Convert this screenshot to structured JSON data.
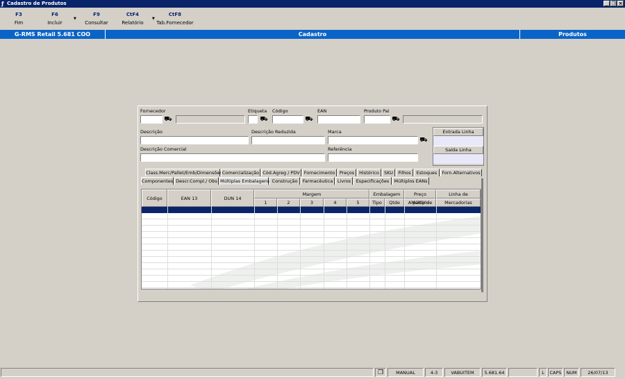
{
  "window": {
    "title": "Cadastro de Produtos"
  },
  "toolbar": [
    {
      "key": "F3",
      "label": "Fim"
    },
    {
      "key": "F6",
      "label": "Incluir"
    },
    {
      "key": "F9",
      "label": "Consultar"
    },
    {
      "key": "CtF4",
      "label": "Relatório"
    },
    {
      "key": "CtF8",
      "label": "Tab.Fornecedor"
    }
  ],
  "header": {
    "left": "G-RMS Retail 5.681 COO",
    "center": "Cadastro",
    "right": "Produtos"
  },
  "form": {
    "fornecedor_label": "Fornecedor",
    "etiqueta_label": "Etiqueta",
    "codigo_label": "Código",
    "ean_label": "EAN",
    "produto_pai_label": "Produto Pai",
    "descricao_label": "Descrição",
    "descricao_reduzida_label": "Descrição Reduzida",
    "marca_label": "Marca",
    "descricao_comercial_label": "Descrição Comercial",
    "referencia_label": "Referência",
    "entrada_linha_label": "Entrada Linha",
    "saida_linha_label": "Saída Linha"
  },
  "tabs_row1": [
    "Class.Merc/Pallet/Emb/Dimensões",
    "Comercialização",
    "Cód.Agreg / PDV",
    "Fornecimento",
    "Preços",
    "Histórico",
    "SKU",
    "Filhos",
    "Estoques",
    "Forn.Alternativos"
  ],
  "tabs_row2": [
    "Componentes",
    "Descr.Compl./ Obs",
    "Múltiplas Embalagens",
    "Construção",
    "Farmacêutica",
    "Livros",
    "Especificações",
    "Múltiplos EANs"
  ],
  "grid": {
    "headers": {
      "codigo": "Código",
      "ean13": "EAN 13",
      "dun14": "DUN 14",
      "margem": "Margem",
      "margem_cols": [
        "1",
        "2",
        "3",
        "4",
        "5"
      ],
      "embalagem": "Embalagem",
      "tipo": "Tipo",
      "qtde": "Qtde",
      "preco_multiplo": "Preço Múltiplo",
      "a_partir_de": "A partir de",
      "linha_de": "Linha de",
      "mercadorias": "Mercadorias"
    }
  },
  "status": {
    "mode": "MANUAL",
    "section": "4-3",
    "user": "VABUITEM",
    "version": "5.681.64",
    "l": "L",
    "caps": "CAPS",
    "num": "NUM",
    "date": "26/07/13"
  }
}
